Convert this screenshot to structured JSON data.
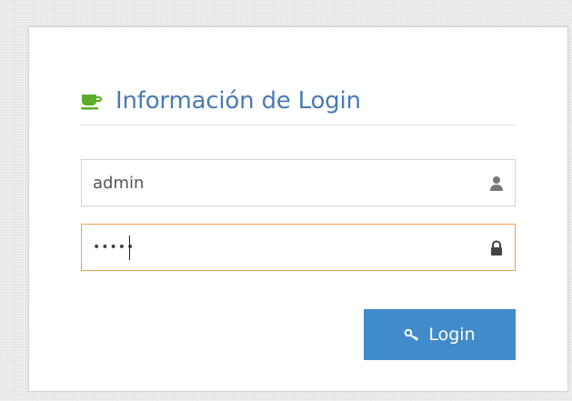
{
  "login": {
    "title": "Información de Login",
    "username_value": "admin",
    "password_value": "12345",
    "submit_label": "Login"
  },
  "icons": {
    "title": "coffee-cup-icon",
    "username": "user-icon",
    "password": "lock-icon",
    "submit": "key-icon"
  },
  "colors": {
    "title": "#4a7bb4",
    "cup": "#5cac2a",
    "button": "#428bca",
    "focus_border": "#f0a050",
    "field_icon": "#777777"
  }
}
